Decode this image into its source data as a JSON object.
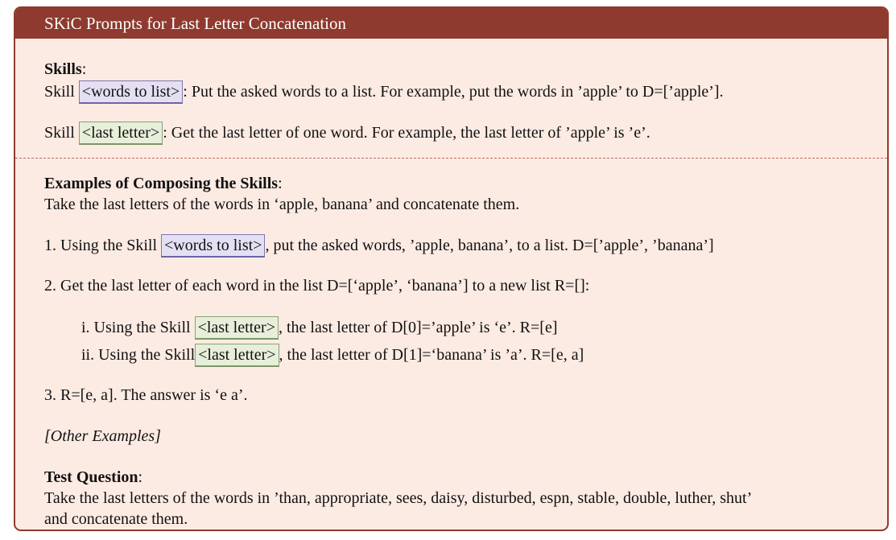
{
  "panel": {
    "title": "SKiC Prompts for Last Letter Concatenation"
  },
  "skills": {
    "heading": "Skills",
    "heading_colon": ":",
    "skill_word": "Skill ",
    "skill1": {
      "tag": "<words to list>",
      "text": ": Put the asked words to a list. For example, put the words in ’apple’ to D=[’apple’]."
    },
    "skill2": {
      "tag": "<last letter>",
      "text": ": Get the last letter of one word. For example, the last letter of ’apple’ is ’e’."
    }
  },
  "examples": {
    "heading": "Examples of Composing the Skills",
    "heading_colon": ":",
    "task": "Take the last letters of the words in ‘apple, banana’ and concatenate them.",
    "step1": {
      "prefix": "1. Using the Skill ",
      "tag": "<words to list>",
      "suffix": ", put the asked words, ’apple, banana’, to a list. D=[’apple’, ’banana’]"
    },
    "step2": {
      "text": "2. Get the last letter of each word in the list D=[‘apple’, ‘banana’] to a new list R=[]:"
    },
    "step2i": {
      "prefix": "i. Using the Skill ",
      "tag": "<last letter>",
      "suffix": ", the last letter of D[0]=’apple’ is ‘e’. R=[e]"
    },
    "step2ii": {
      "prefix": "ii. Using the Skill",
      "tag": "<last letter>",
      "suffix": ", the last letter of D[1]=‘banana’ is ’a’. R=[e, a]"
    },
    "step3": {
      "text": "3. R=[e, a]. The answer is ‘e a’."
    },
    "other": "[Other Examples]"
  },
  "test": {
    "heading": "Test Question",
    "heading_colon": ":",
    "line1": "Take the last letters of the words in ’than, appropriate, sees, daisy, disturbed, espn, stable, double, luther, shut’",
    "line2": "and concatenate them."
  },
  "colors": {
    "frame": "#8e3a2e",
    "panel_background": "#fcebe3",
    "words_to_list_tag": "#e4e0f3",
    "last_letter_tag": "#e7efda"
  }
}
